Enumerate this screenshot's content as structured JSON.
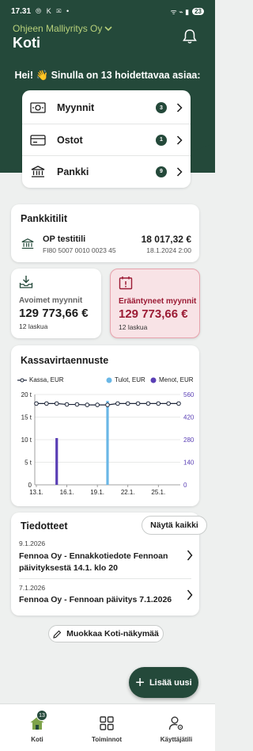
{
  "status_bar": {
    "time": "17.31",
    "left_icons": "⦾ K ✉ •",
    "right_icons": "ᯤ ⌁ ▮",
    "battery": "23"
  },
  "header": {
    "company": "Ohjeen Malliyritys Oy",
    "title": "Koti"
  },
  "greeting": "Hei! 👋 Sinulla on 13 hoidettavaa asiaa:",
  "tasks": [
    {
      "label": "Myynnit",
      "count": "3",
      "icon": "money-icon"
    },
    {
      "label": "Ostot",
      "count": "1",
      "icon": "card-icon"
    },
    {
      "label": "Pankki",
      "count": "9",
      "icon": "bank-icon"
    }
  ],
  "bank_accounts": {
    "title": "Pankkitilit",
    "account": {
      "name": "OP testitili",
      "iban": "FI80 5007 0010 0023 45",
      "balance": "18 017,32 €",
      "updated": "18.1.2024 2:00"
    }
  },
  "open_sales": {
    "label": "Avoimet myynnit",
    "value": "129 773,66 €",
    "count": "12 laskua"
  },
  "overdue_sales": {
    "label": "Erääntyneet myynnit",
    "value": "129 773,66 €",
    "count": "12 laskua"
  },
  "cashflow": {
    "title": "Kassavirtaennuste",
    "legend": {
      "kassa": "Kassa, EUR",
      "tulot": "Tulot, EUR",
      "menot": "Menot, EUR"
    },
    "colors": {
      "kassa": "#1c2538",
      "tulot": "#6ab7e6",
      "menot": "#5a3fb5"
    }
  },
  "chart_data": {
    "type": "line",
    "title": "Kassavirtaennuste",
    "x_ticks": [
      "13.1.",
      "16.1.",
      "19.1.",
      "22.1.",
      "25.1."
    ],
    "left_axis_ticks": [
      "0",
      "5 t",
      "10 t",
      "15 t",
      "20 t"
    ],
    "right_axis_ticks": [
      "0",
      "140",
      "280",
      "420",
      "560"
    ],
    "ylim_left": [
      0,
      20000
    ],
    "ylim_right": [
      0,
      560
    ],
    "series": [
      {
        "name": "Kassa, EUR",
        "type": "line",
        "axis": "left",
        "x": [
          "13.1.",
          "14.1.",
          "15.1.",
          "16.1.",
          "17.1.",
          "18.1.",
          "19.1.",
          "20.1.",
          "21.1.",
          "22.1.",
          "23.1.",
          "24.1.",
          "25.1.",
          "26.1.",
          "27.1."
        ],
        "values": [
          18000,
          18000,
          18000,
          17800,
          17800,
          17700,
          17700,
          17700,
          18000,
          18000,
          18000,
          18000,
          18000,
          18000,
          18000
        ]
      },
      {
        "name": "Tulot, EUR",
        "type": "bar",
        "axis": "right",
        "x": [
          "20.1."
        ],
        "values": [
          520
        ]
      },
      {
        "name": "Menot, EUR",
        "type": "bar",
        "axis": "right",
        "x": [
          "15.1."
        ],
        "values": [
          290
        ]
      }
    ],
    "legend": "top"
  },
  "news": {
    "title": "Tiedotteet",
    "show_all": "Näytä kaikki",
    "items": [
      {
        "date": "9.1.2026",
        "text": "Fennoa Oy - Ennakkotiedote Fennoan päivityksestä 14.1. klo 20"
      },
      {
        "date": "7.1.2026",
        "text": "Fennoa Oy - Fennoan päivitys 7.1.2026"
      }
    ]
  },
  "edit_home": "Muokkaa Koti-näkymää",
  "fab_label": "Lisää uusi",
  "nav": [
    {
      "label": "Koti",
      "badge": "13"
    },
    {
      "label": "Toiminnot"
    },
    {
      "label": "Käyttäjätili"
    }
  ]
}
